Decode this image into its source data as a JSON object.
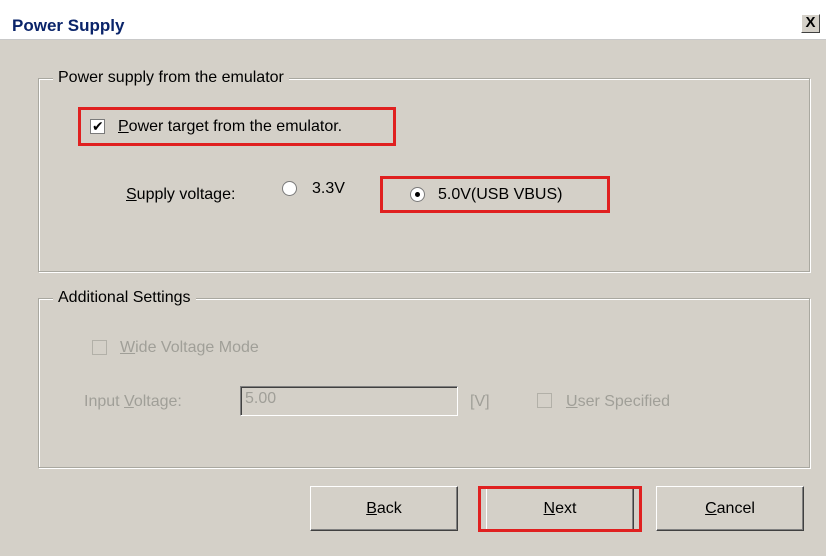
{
  "window": {
    "title": "Power Supply",
    "close_glyph": "X"
  },
  "group_power": {
    "legend": "Power supply from the emulator",
    "power_target": {
      "label": "Power target from the emulator.",
      "checked": true
    },
    "supply_voltage_label": "Supply voltage:",
    "options": [
      {
        "label": "3.3V",
        "selected": false
      },
      {
        "label": "5.0V(USB VBUS)",
        "selected": true
      }
    ]
  },
  "group_additional": {
    "legend": "Additional Settings",
    "wide_voltage": {
      "label": "Wide Voltage Mode",
      "checked": false,
      "enabled": false
    },
    "input_voltage_label": "Input Voltage:",
    "input_voltage_value": "5.00",
    "unit": "[V]",
    "user_specified": {
      "label": "User Specified",
      "checked": false,
      "enabled": false
    }
  },
  "buttons": {
    "back": "Back",
    "next": "Next",
    "cancel": "Cancel"
  },
  "colors": {
    "highlight": "#e02020",
    "dialog_bg": "#d4d0c8",
    "title_text": "#0a246a"
  }
}
